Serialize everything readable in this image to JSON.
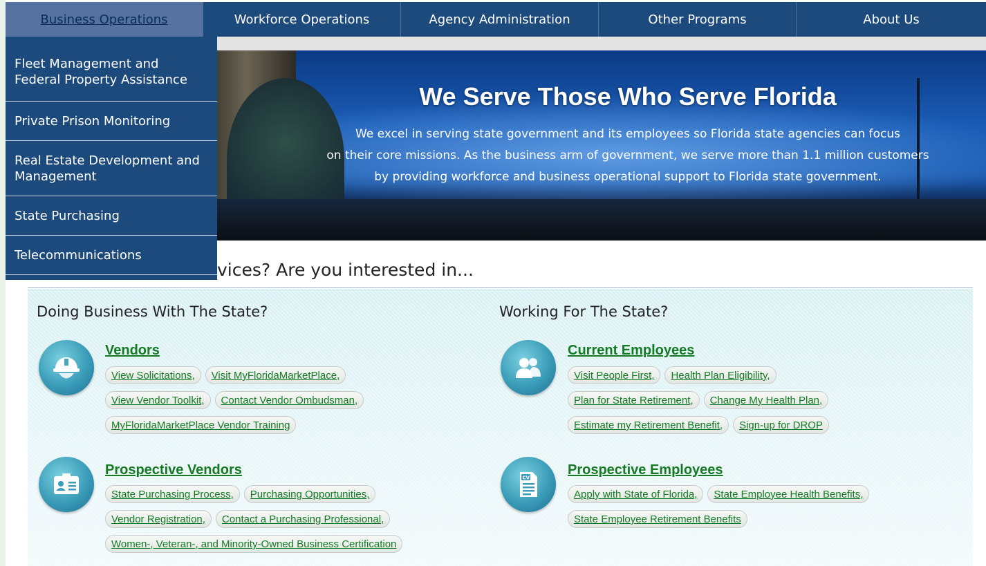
{
  "nav": {
    "items": [
      {
        "label": "Business Operations",
        "active": true
      },
      {
        "label": "Workforce Operations",
        "active": false
      },
      {
        "label": "Agency Administration",
        "active": false
      },
      {
        "label": "Other Programs",
        "active": false
      },
      {
        "label": "About Us",
        "active": false
      }
    ]
  },
  "dropdown": {
    "items": [
      "Fleet Management and Federal Property Assistance",
      "Private Prison Monitoring",
      "Real Estate Development and Management",
      "State Purchasing",
      "Telecommunications"
    ]
  },
  "hero": {
    "title": "We Serve Those Who Serve Florida",
    "lines": [
      "We excel in serving state government and its employees so Florida state agencies can focus",
      "on their core missions. As the business arm of government, we serve more than 1.1 million customers",
      "by providing workforce and business operational support to Florida state government."
    ]
  },
  "main": {
    "heading_visible": "vices? Are you interested in...",
    "left_column": {
      "title": "Doing Business With The State?",
      "sections": [
        {
          "title": "Vendors",
          "icon": "hard-hat-icon",
          "links": [
            [
              "View Solicitations,",
              "Visit MyFloridaMarketPlace,"
            ],
            [
              "View Vendor Toolkit,",
              "Contact Vendor Ombudsman,"
            ],
            [
              "MyFloridaMarketPlace Vendor Training"
            ]
          ]
        },
        {
          "title": "Prospective Vendors",
          "icon": "id-card-icon",
          "links": [
            [
              "State Purchasing Process,",
              "Purchasing Opportunities,"
            ],
            [
              "Vendor Registration,",
              "Contact a Purchasing Professional,"
            ],
            [
              "Women-, Veteran-, and Minority-Owned Business Certification"
            ]
          ]
        }
      ]
    },
    "right_column": {
      "title": "Working For The State?",
      "sections": [
        {
          "title": "Current Employees",
          "icon": "people-icon",
          "links": [
            [
              "Visit People First,",
              "Health Plan Eligibility,"
            ],
            [
              "Plan for State Retirement,",
              "Change My Health Plan,"
            ],
            [
              "Estimate my Retirement Benefit,",
              "Sign-up for DROP"
            ]
          ]
        },
        {
          "title": "Prospective Employees",
          "icon": "cv-document-icon",
          "links": [
            [
              "Apply with State of Florida,",
              "State Employee Health Benefits,"
            ],
            [
              "State Employee Retirement Benefits"
            ]
          ]
        }
      ]
    }
  },
  "colors": {
    "nav_bg": "#1d4a7c",
    "nav_active_bg": "#5572a0",
    "link_green": "#147a24",
    "panel_bg": "#d8f0f3"
  }
}
